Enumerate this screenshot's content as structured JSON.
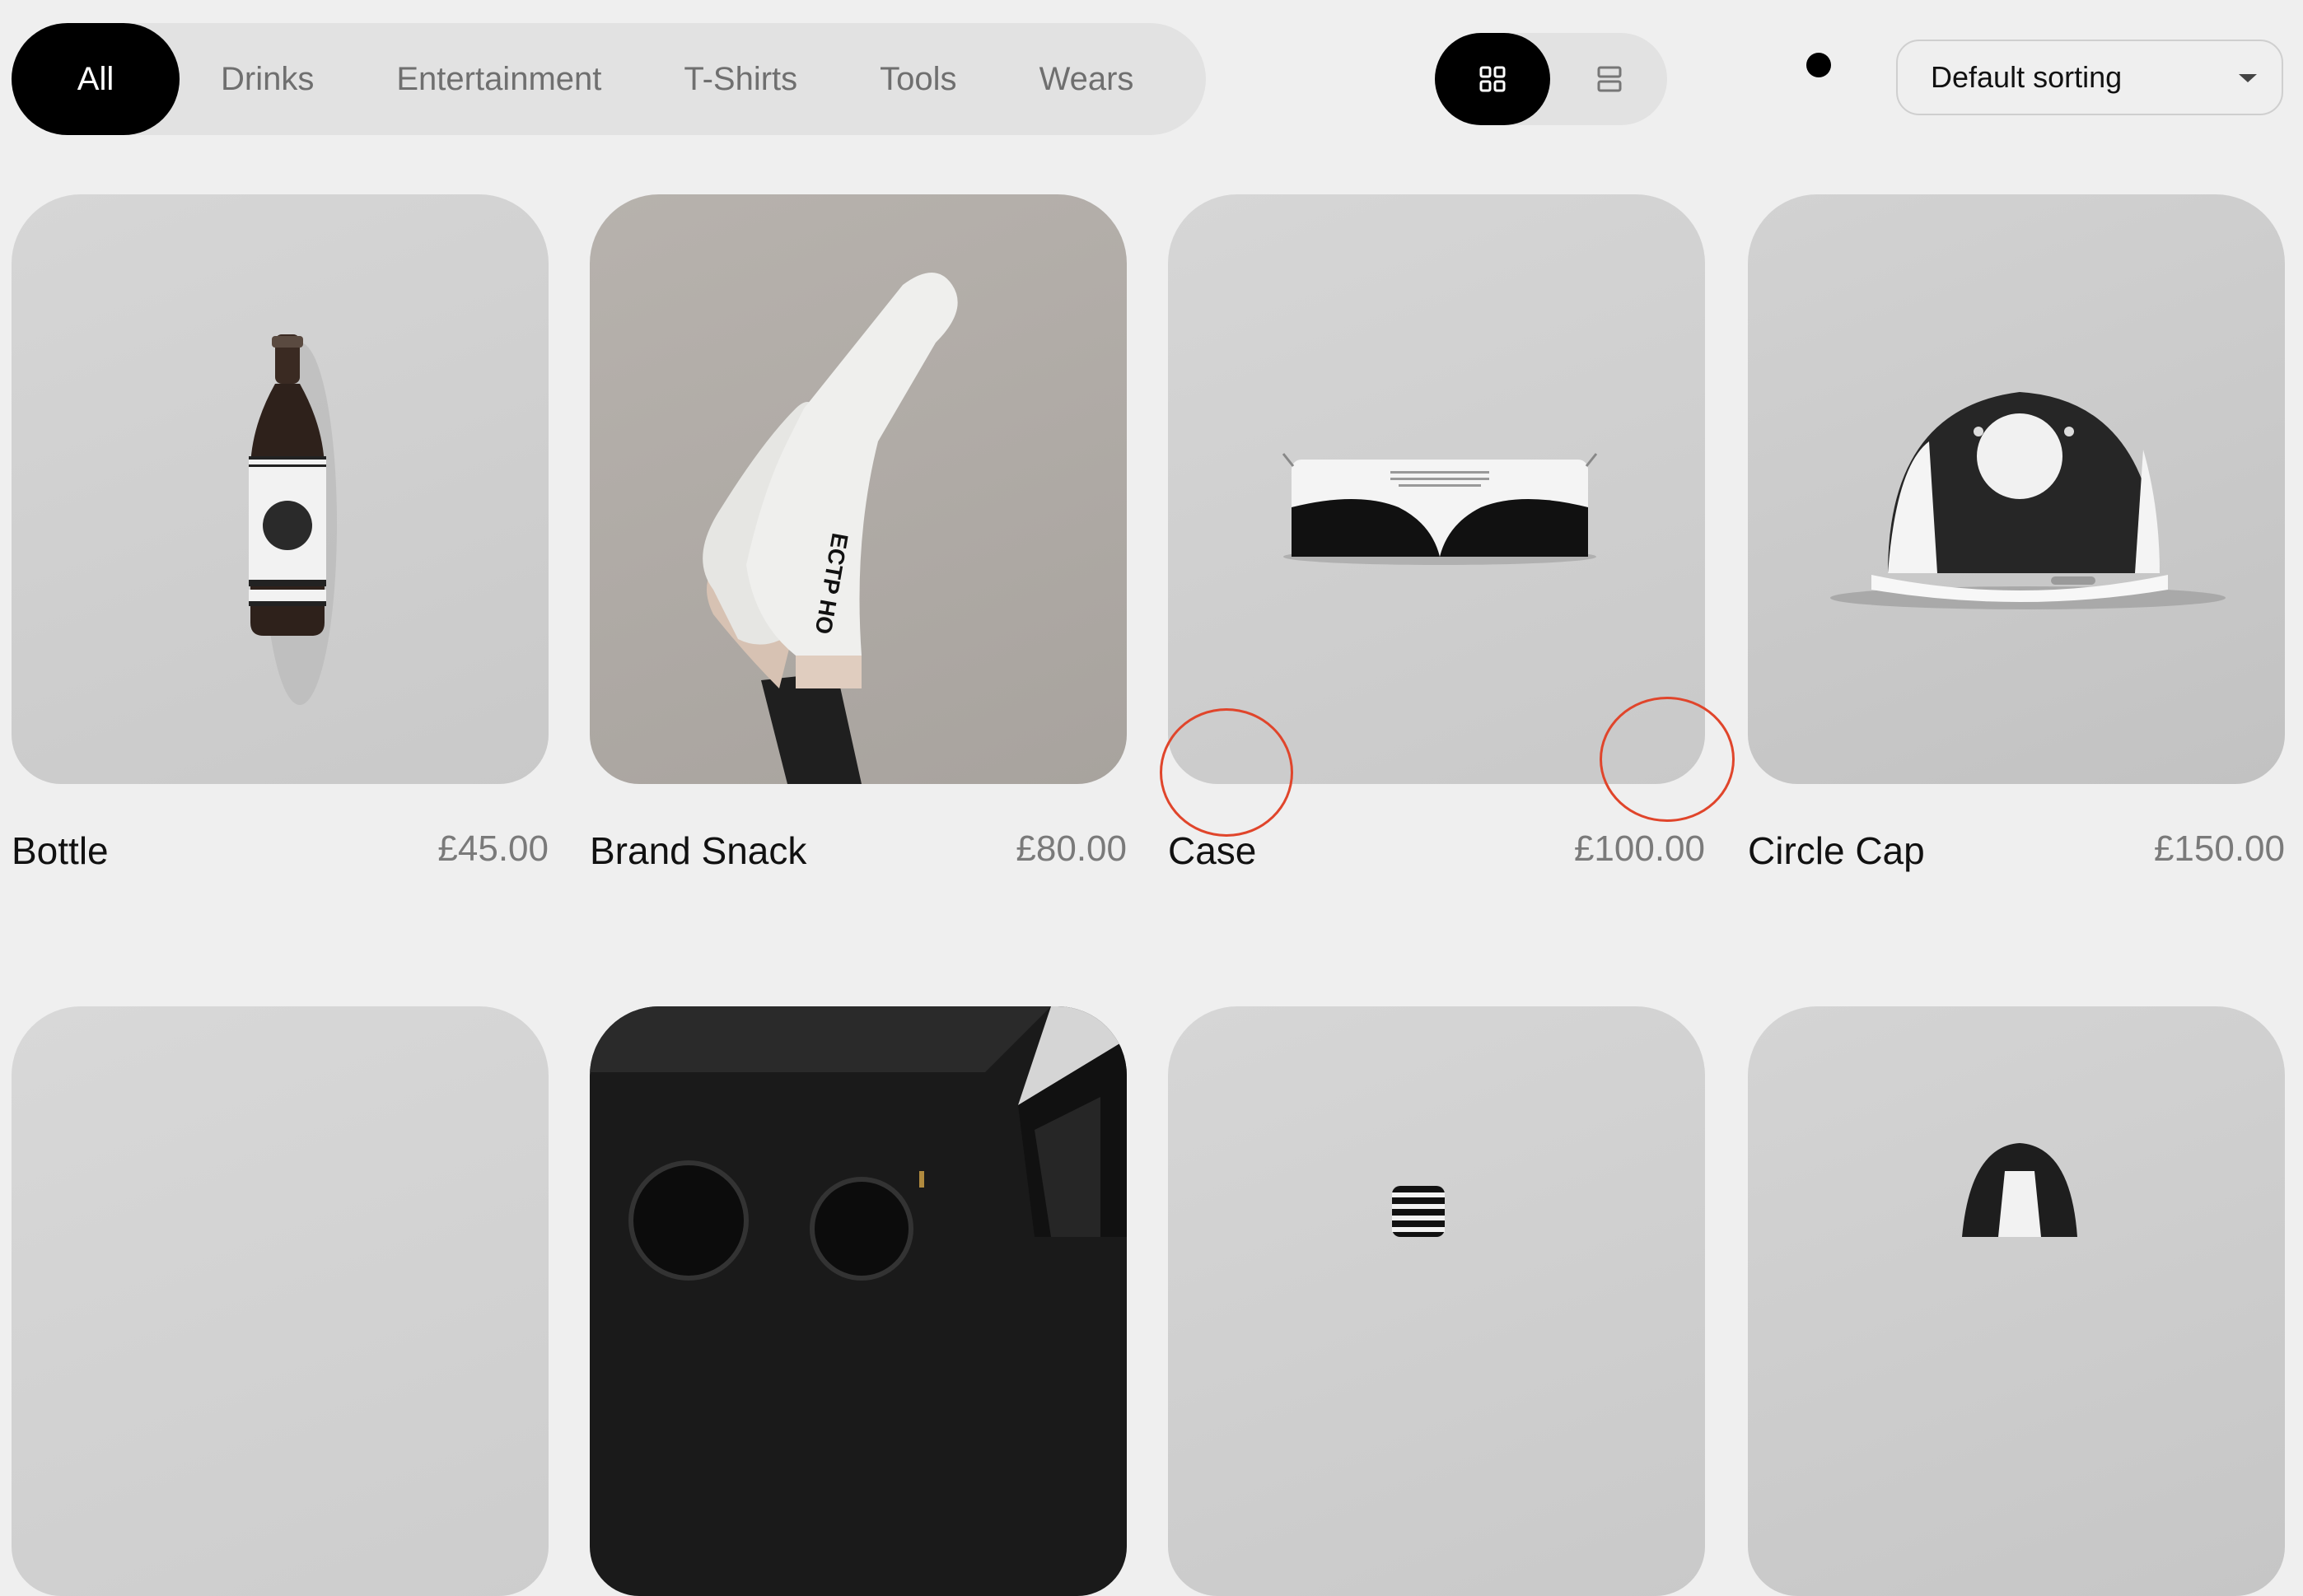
{
  "filters": {
    "items": [
      {
        "label": "All",
        "active": true
      },
      {
        "label": "Drinks"
      },
      {
        "label": "Entertainment"
      },
      {
        "label": "T-Shirts"
      },
      {
        "label": "Tools"
      },
      {
        "label": "Wears"
      }
    ]
  },
  "view_toggle": {
    "selected": "grid"
  },
  "sort": {
    "selected": "Default sorting"
  },
  "colors": {
    "accent": "#000000",
    "background": "#efefef",
    "price": "#7a7a7a",
    "highlight": "#e0452b"
  },
  "products": [
    {
      "name": "Bottle",
      "price": "£45.00"
    },
    {
      "name": "Brand Snack",
      "price": "£80.00"
    },
    {
      "name": "Case",
      "price": "£100.00"
    },
    {
      "name": "Circle Cap",
      "price": "£150.00"
    }
  ]
}
